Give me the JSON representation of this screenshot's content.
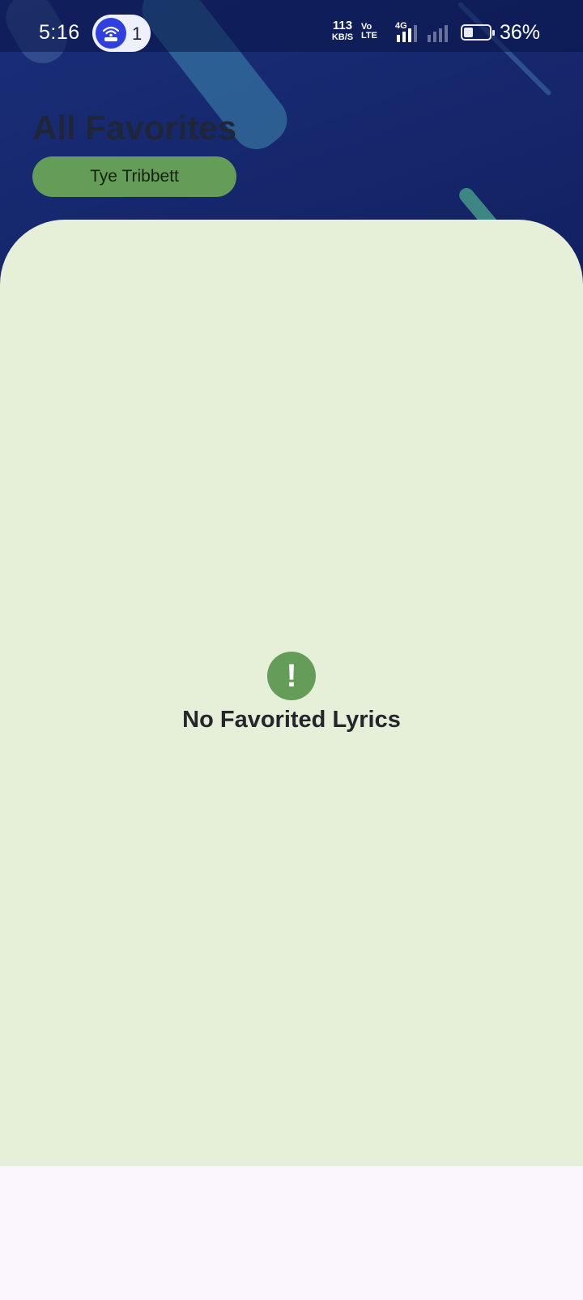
{
  "status_bar": {
    "time": "5:16",
    "hotspot_icon": "wifi-hotspot-icon",
    "hotspot_count": "1",
    "net_speed_value": "113",
    "net_speed_unit": "KB/S",
    "volte_top": "Vo",
    "volte_bottom": "LTE",
    "network_type": "4G",
    "battery_percent_text": "36%",
    "battery_level": 0.36
  },
  "header": {
    "title": "All Favorites",
    "filter_chip_label": "Tye Tribbett"
  },
  "empty_state": {
    "icon": "exclamation-icon",
    "icon_glyph": "!",
    "message": "No Favorited Lyrics"
  },
  "colors": {
    "accent_green": "#649d57",
    "card_background": "#e6efd8",
    "header_blue": "#16286e"
  }
}
